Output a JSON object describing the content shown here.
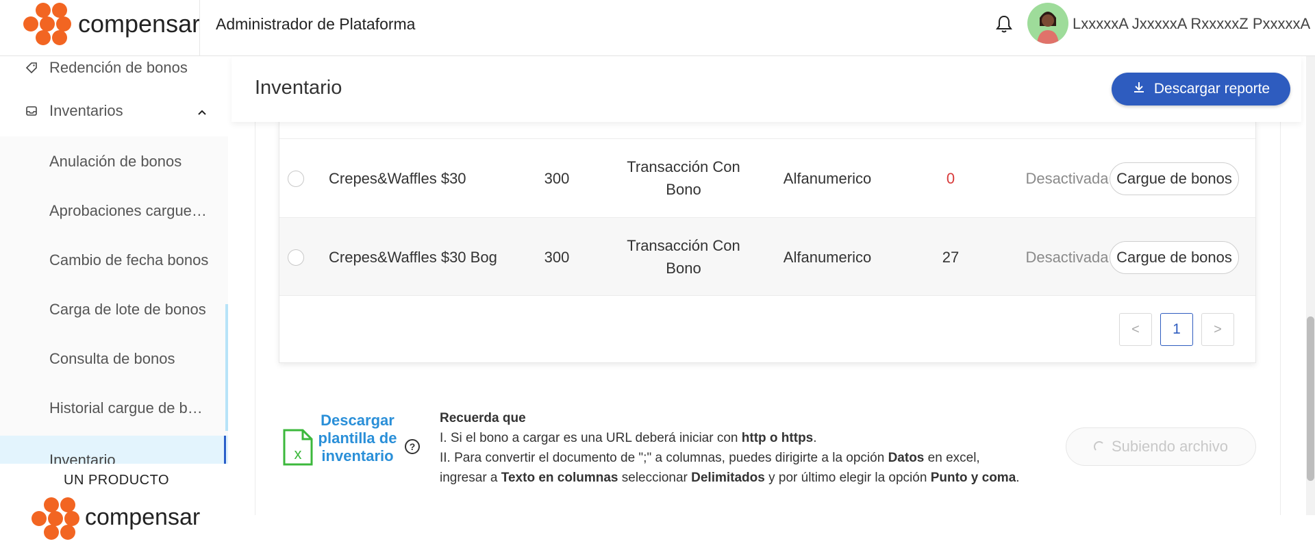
{
  "header": {
    "brand": "compensar",
    "platform_title": "Administrador de Plataforma",
    "user_name": "LxxxxxA JxxxxxA RxxxxxZ PxxxxxA"
  },
  "sidebar": {
    "items": [
      {
        "label": "Redención de bonos"
      },
      {
        "label": "Inventarios"
      },
      {
        "label": "Anulación de bonos"
      },
      {
        "label": "Aprobaciones cargue de bonos"
      },
      {
        "label": "Cambio de fecha bonos"
      },
      {
        "label": "Carga de lote de bonos"
      },
      {
        "label": "Consulta de bonos"
      },
      {
        "label": "Historial cargue de bonos"
      },
      {
        "label": "Inventario"
      }
    ],
    "footer_label": "UN PRODUCTO",
    "footer_brand": "compensar"
  },
  "page": {
    "title": "Inventario",
    "download_report_label": "Descargar reporte"
  },
  "table": {
    "rows": [
      {
        "name": "Crepes&Waffles $30",
        "value": "300",
        "type": "Transacción Con Bono",
        "code_type": "Alfanumerico",
        "count": "0",
        "status": "Desactivada",
        "action": "Cargue de bonos"
      },
      {
        "name": "Crepes&Waffles $30 Bog",
        "value": "300",
        "type": "Transacción Con Bono",
        "code_type": "Alfanumerico",
        "count": "27",
        "status": "Desactivada",
        "action": "Cargue de bonos"
      }
    ],
    "pagination": {
      "prev": "<",
      "current": "1",
      "next": ">"
    }
  },
  "footer_info": {
    "download_template_label": "Descargar plantilla de inventario",
    "help_symbol": "?",
    "reminder_title": "Recuerda que",
    "line1_prefix": "I. Si el bono a cargar es una URL deberá iniciar con ",
    "line1_bold": "http o https",
    "line1_suffix": ".",
    "line2_prefix": "II. Para convertir el documento de \";\" a columnas, puedes dirigirte a la opción ",
    "line2_bold1": "Datos",
    "line2_mid1": " en excel,",
    "line3_prefix": "ingresar a ",
    "line3_bold1": "Texto en columnas",
    "line3_mid1": " seleccionar ",
    "line3_bold2": "Delimitados",
    "line3_mid2": " y por último elegir la opción ",
    "line3_bold3": "Punto y coma",
    "line3_suffix": ".",
    "upload_label": "Subiendo archivo"
  },
  "colors": {
    "brand_orange": "#f26522",
    "primary_blue": "#2e5cbf",
    "link_blue": "#2a8fd8",
    "error_red": "#d83b3b"
  }
}
